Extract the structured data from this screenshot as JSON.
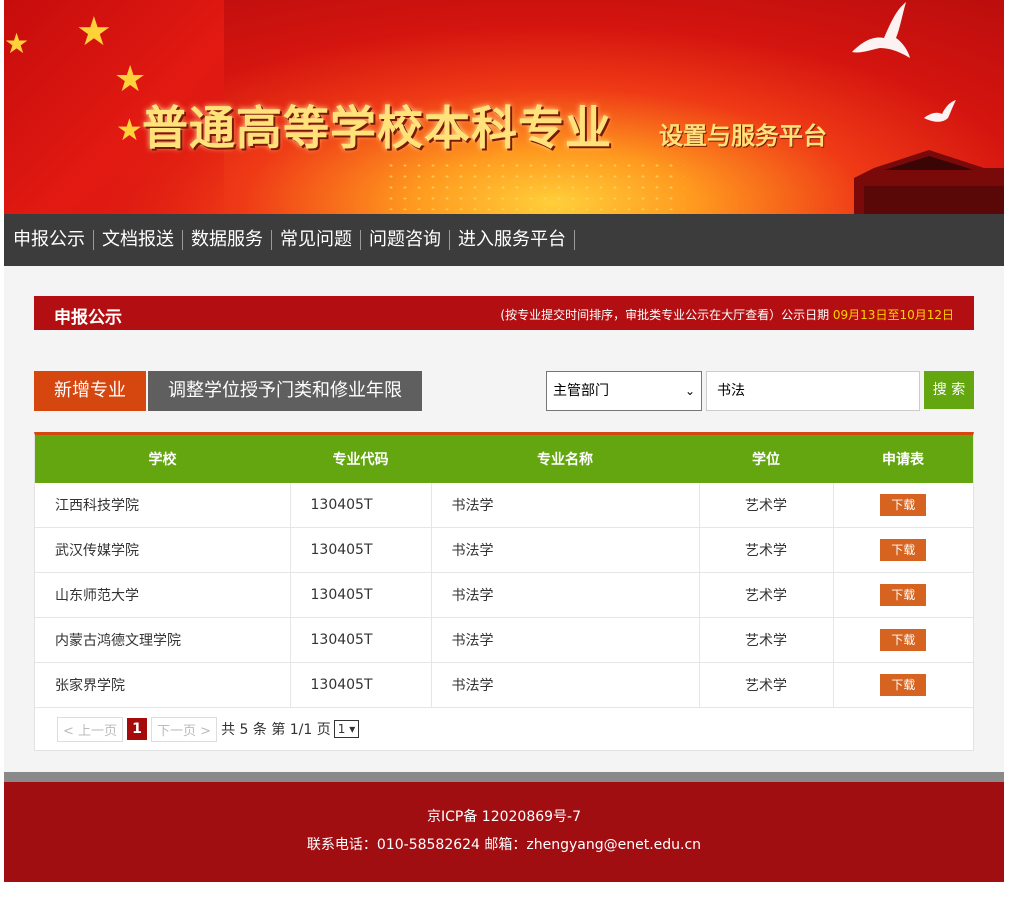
{
  "banner": {
    "title": "普通高等学校本科专业",
    "subtitle": "设置与服务平台"
  },
  "nav": [
    "申报公示",
    "文档报送",
    "数据服务",
    "常见问题",
    "问题咨询",
    "进入服务平台"
  ],
  "section": {
    "title": "申报公示",
    "note": "(按专业提交时间排序，审批类专业公示在大厅查看）公示日期 ",
    "date": "09月13日至10月12日"
  },
  "tabs": {
    "new": "新增专业",
    "adjust": "调整学位授予门类和修业年限"
  },
  "search": {
    "dept": "主管部门",
    "keyword": "书法",
    "button": "搜 索"
  },
  "table": {
    "headers": [
      "学校",
      "专业代码",
      "专业名称",
      "学位",
      "申请表"
    ],
    "rows": [
      {
        "school": "江西科技学院",
        "code": "130405T",
        "name": "书法学",
        "degree": "艺术学",
        "action": "下载"
      },
      {
        "school": "武汉传媒学院",
        "code": "130405T",
        "name": "书法学",
        "degree": "艺术学",
        "action": "下载"
      },
      {
        "school": "山东师范大学",
        "code": "130405T",
        "name": "书法学",
        "degree": "艺术学",
        "action": "下载"
      },
      {
        "school": "内蒙古鸿德文理学院",
        "code": "130405T",
        "name": "书法学",
        "degree": "艺术学",
        "action": "下载"
      },
      {
        "school": "张家界学院",
        "code": "130405T",
        "name": "书法学",
        "degree": "艺术学",
        "action": "下载"
      }
    ]
  },
  "pager": {
    "prev": "< 上一页",
    "current": "1",
    "next": "下一页 >",
    "summary": "共 5 条 第 1/1 页",
    "select": "1"
  },
  "footer": {
    "icp": "京ICP备 12020869号-7",
    "contact": "联系电话：010-58582624   邮箱：zhengyang@enet.edu.cn"
  }
}
